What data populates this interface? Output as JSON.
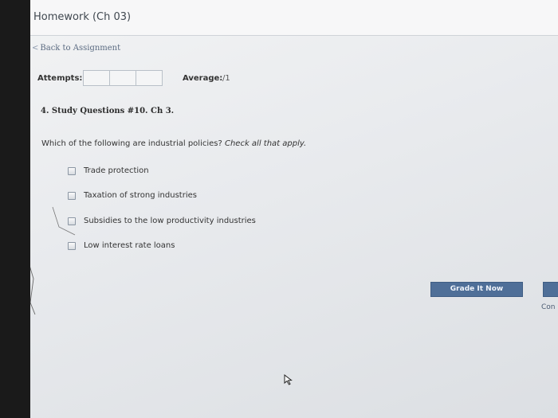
{
  "header": {
    "title": "Homework (Ch 03)"
  },
  "nav": {
    "back_chevron": "<",
    "back_label": "Back to Assignment"
  },
  "stats": {
    "attempts_label": "Attempts:",
    "attempt_boxes": 3,
    "average_label": "Average:",
    "average_value": "/1"
  },
  "question": {
    "title": "4. Study Questions #10. Ch 3.",
    "prompt": "Which of the following are industrial policies?",
    "instruction": "Check all that apply.",
    "options": [
      {
        "label": "Trade protection",
        "checked": false
      },
      {
        "label": "Taxation of strong industries",
        "checked": false
      },
      {
        "label": "Subsidies to the low productivity industries",
        "checked": false
      },
      {
        "label": "Low interest rate loans",
        "checked": false
      }
    ]
  },
  "actions": {
    "grade_label": "Grade It Now",
    "continue_label": "Con"
  },
  "colors": {
    "button_bg": "#4f6f98",
    "button_text": "#f0f4fa",
    "link": "#5a6a80"
  },
  "icons": {
    "cursor": "mouse-pointer-icon"
  }
}
